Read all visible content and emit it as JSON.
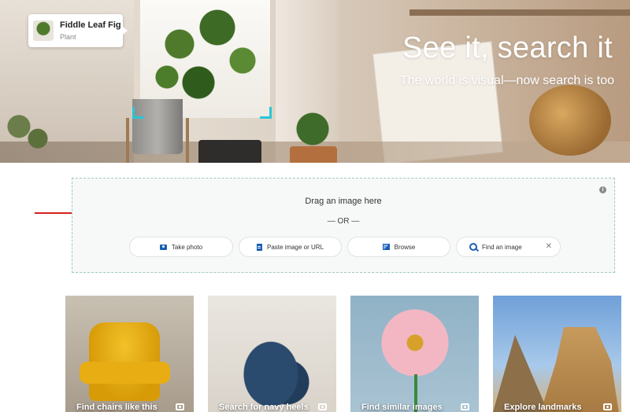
{
  "hero": {
    "title": "See it, search it",
    "subtitle": "The world is visual—now search is too",
    "tag": {
      "name": "Fiddle Leaf Fig",
      "type": "Plant"
    }
  },
  "dropzone": {
    "drag_text": "Drag an image here",
    "or_text": "— OR —",
    "buttons": [
      {
        "label": "Take photo",
        "icon": "camera-icon"
      },
      {
        "label": "Paste image or URL",
        "icon": "document-icon"
      },
      {
        "label": "Browse",
        "icon": "image-icon"
      },
      {
        "label": "Find an image",
        "icon": "search-icon"
      }
    ],
    "close_glyph": "✕",
    "info_glyph": "i"
  },
  "cards": [
    {
      "label": "Find chairs like this"
    },
    {
      "label": "Search for navy heels"
    },
    {
      "label": "Find similar images"
    },
    {
      "label": "Explore landmarks"
    }
  ],
  "colors": {
    "accent": "#1a5fb4",
    "bracket": "#29c6d6",
    "arrow": "#d81e1e",
    "dropzone_border": "#9fc9bf"
  }
}
